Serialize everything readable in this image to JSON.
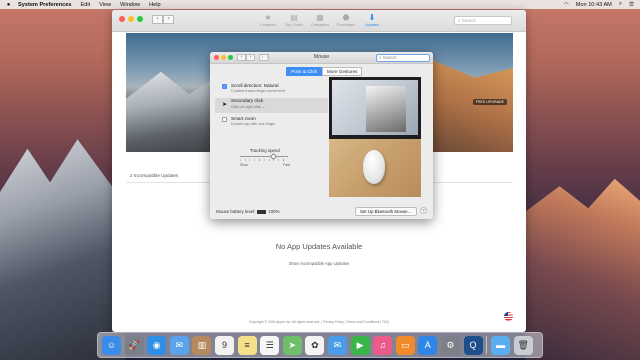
{
  "menubar": {
    "apple": "",
    "app_name": "System Preferences",
    "items": [
      "Edit",
      "View",
      "Window",
      "Help"
    ],
    "time": "Mon 10:43 AM"
  },
  "appstore": {
    "tabs": [
      {
        "label": "Featured",
        "icon": "★"
      },
      {
        "label": "Top Charts",
        "icon": "▤"
      },
      {
        "label": "Categories",
        "icon": "▦"
      },
      {
        "label": "Purchased",
        "icon": "⬣"
      },
      {
        "label": "Updates",
        "icon": "⬇"
      }
    ],
    "search_placeholder": "Search",
    "banner_badge": "FREE UPGRADE",
    "incompatible_count": "2 Incompatible Updates",
    "no_updates": "No App Updates Available",
    "show_incompatible": "Show Incompatible App Updates",
    "footer": "Copyright © 2016 Apple Inc. All rights reserved.  |  Privacy Policy  |  Terms and Conditions  |  FAQ"
  },
  "mouse": {
    "title": "Mouse",
    "search_placeholder": "Search",
    "tabs": [
      "Point & Click",
      "More Gestures"
    ],
    "options": [
      {
        "title": "Scroll direction: Natural",
        "desc": "Content tracks finger movement",
        "checked": true
      },
      {
        "title": "Secondary click",
        "desc": "Click on right side ⌄",
        "checked": false
      },
      {
        "title": "Smart zoom",
        "desc": "Double-tap with one finger",
        "checked": false
      }
    ],
    "tracking_title": "Tracking speed",
    "tracking_slow": "Slow",
    "tracking_fast": "Fast",
    "tracking_level": 0.7,
    "battery_label": "Mouse battery level:",
    "battery_value": "100%",
    "bt_button": "Set Up Bluetooth Mouse…",
    "help": "?"
  },
  "dock": [
    {
      "name": "finder-icon",
      "glyph": "☺",
      "color": "#3b8ce8"
    },
    {
      "name": "launchpad-icon",
      "glyph": "🚀",
      "color": "#7a7f8a"
    },
    {
      "name": "safari-icon",
      "glyph": "◉",
      "color": "#2f8fe6"
    },
    {
      "name": "mail-icon",
      "glyph": "✉",
      "color": "#5aa3ea"
    },
    {
      "name": "contacts-icon",
      "glyph": "▥",
      "color": "#b58a5e"
    },
    {
      "name": "calendar-icon",
      "glyph": "9",
      "color": "#f2f2f2"
    },
    {
      "name": "notes-icon",
      "glyph": "≡",
      "color": "#f4e08a"
    },
    {
      "name": "reminders-icon",
      "glyph": "☰",
      "color": "#f6f6f6"
    },
    {
      "name": "maps-icon",
      "glyph": "➤",
      "color": "#6fbf6a"
    },
    {
      "name": "photos-icon",
      "glyph": "✿",
      "color": "#f4f4f4"
    },
    {
      "name": "messages-icon",
      "glyph": "✉",
      "color": "#4a9be8"
    },
    {
      "name": "facetime-icon",
      "glyph": "▶",
      "color": "#3ab54a"
    },
    {
      "name": "itunes-icon",
      "glyph": "♫",
      "color": "#ea5a8a"
    },
    {
      "name": "ibooks-icon",
      "glyph": "▭",
      "color": "#f08a2a"
    },
    {
      "name": "appstore-icon",
      "glyph": "A",
      "color": "#2e86e6"
    },
    {
      "name": "sysprefs-icon",
      "glyph": "⚙",
      "color": "#7d8088"
    },
    {
      "name": "quicktime-icon",
      "glyph": "Q",
      "color": "#1f4f8a"
    },
    {
      "name": "folder-icon",
      "glyph": "▬",
      "color": "#5aaef0"
    },
    {
      "name": "trash-icon",
      "glyph": "🗑",
      "color": "#c9ccd2"
    }
  ]
}
